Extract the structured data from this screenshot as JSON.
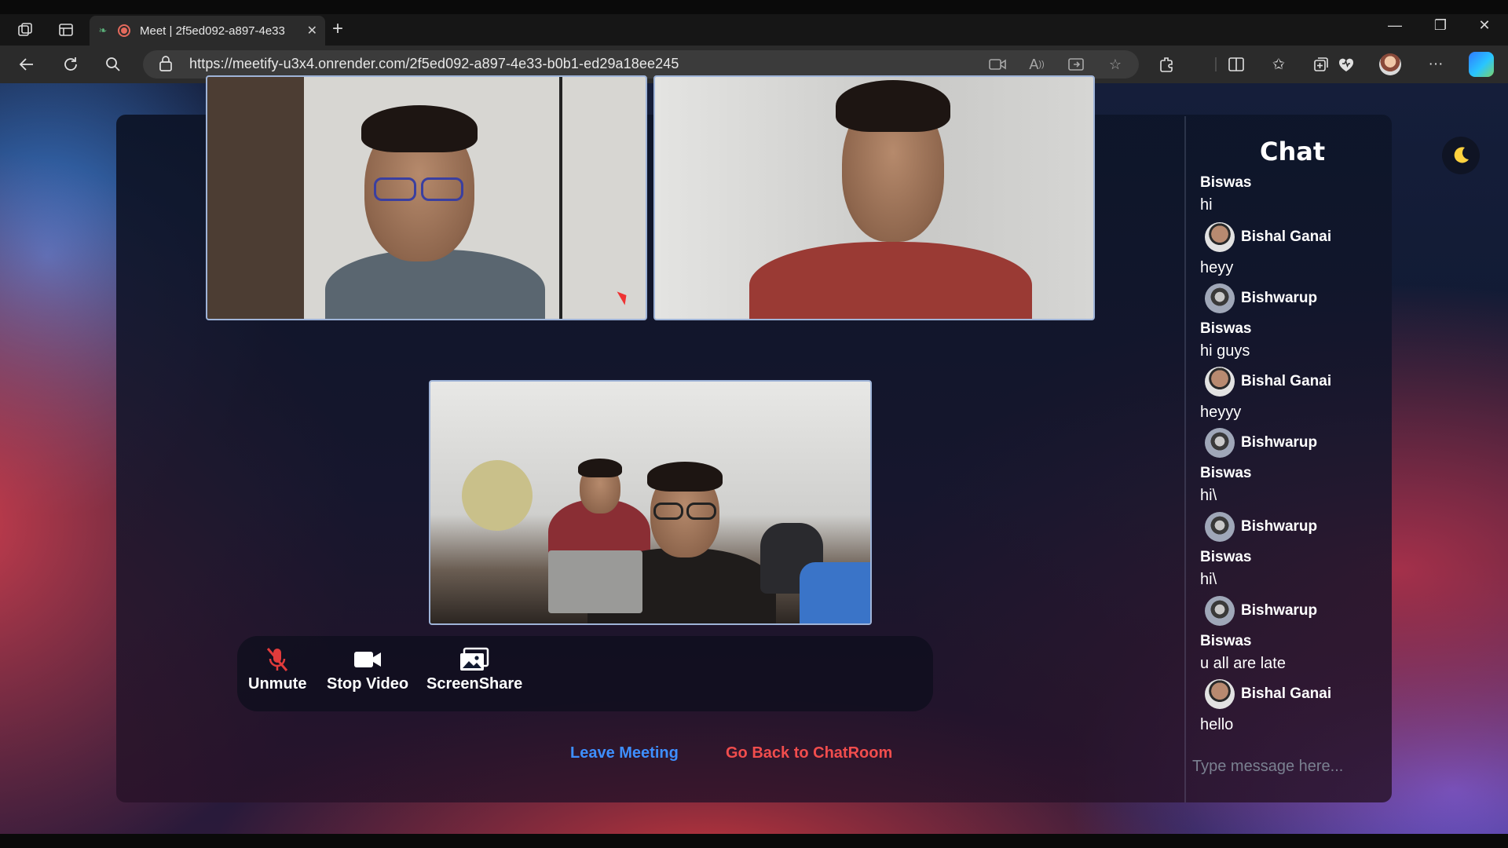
{
  "browser": {
    "tab_title": "Meet | 2f5ed092-a897-4e33",
    "url": "https://meetify-u3x4.onrender.com/2f5ed092-a897-4e33-b0b1-ed29a18ee245"
  },
  "controls": {
    "unmute": "Unmute",
    "stop_video": "Stop Video",
    "screen_share": "ScreenShare",
    "leave": "Leave Meeting",
    "go_back": "Go Back to ChatRoom"
  },
  "chat": {
    "title": "Chat",
    "messages": [
      {
        "name": "Biswas",
        "text": "hi"
      },
      {
        "name": "Bishal Ganai",
        "text": "heyy"
      },
      {
        "name": "Bishwarup",
        "name2": "Biswas",
        "text": "hi guys"
      },
      {
        "name": "Bishal Ganai",
        "text": "heyyy"
      },
      {
        "name": "Bishwarup",
        "name2": "Biswas",
        "text": "hi\\"
      },
      {
        "name": "Bishwarup",
        "name2": "Biswas",
        "text": "hi\\"
      },
      {
        "name": "Bishwarup",
        "name2": "Biswas",
        "text": "u all are late"
      },
      {
        "name": "Bishal Ganai",
        "text": "hello"
      }
    ],
    "input_placeholder": "Type message here..."
  },
  "colors": {
    "leave": "#3e8fff",
    "go_back": "#f14d4d",
    "mic_off": "#e23b3b",
    "moon": "#ffd23f"
  }
}
